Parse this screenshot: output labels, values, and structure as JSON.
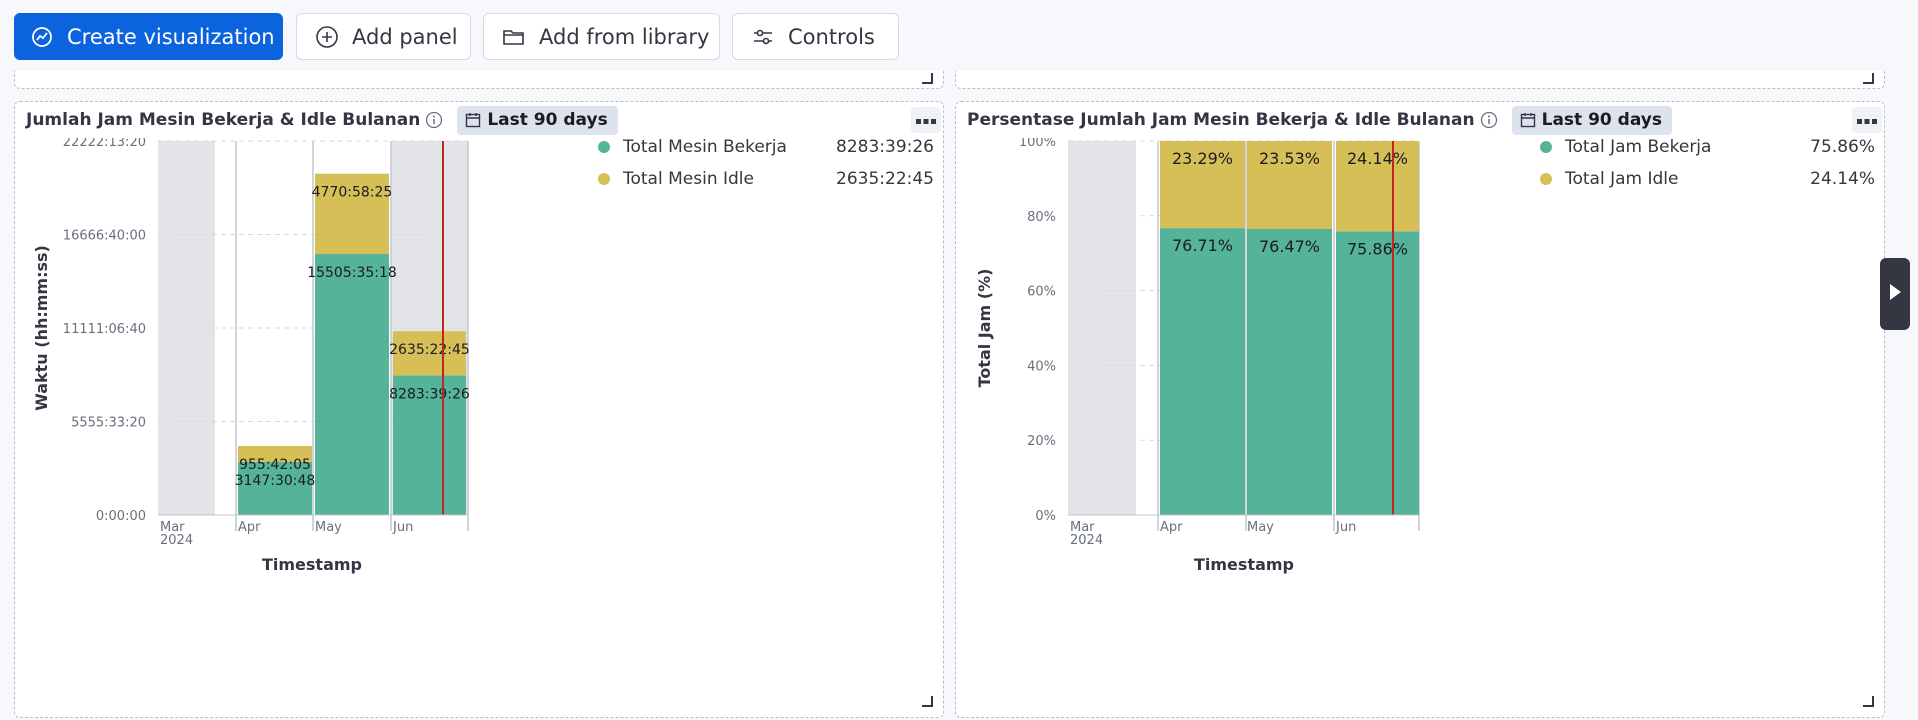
{
  "toolbar": {
    "create_label": "Create visualization",
    "add_panel_label": "Add panel",
    "add_library_label": "Add from library",
    "controls_label": "Controls"
  },
  "panel_left": {
    "title": "Jumlah Jam Mesin Bekerja & Idle Bulanan",
    "time_badge": "Last 90 days",
    "legend": [
      {
        "label": "Total Mesin Bekerja",
        "value": "8283:39:26",
        "color": "#54b399"
      },
      {
        "label": "Total Mesin Idle",
        "value": "2635:22:45",
        "color": "#d6bf57"
      }
    ]
  },
  "panel_right": {
    "title": "Persentase Jumlah Jam Mesin Bekerja & Idle Bulanan",
    "time_badge": "Last 90 days",
    "legend": [
      {
        "label": "Total Jam Bekerja",
        "value": "75.86%",
        "color": "#54b399"
      },
      {
        "label": "Total Jam Idle",
        "value": "24.14%",
        "color": "#d6bf57"
      }
    ]
  },
  "chart_data": [
    {
      "type": "bar",
      "stacked": true,
      "categories": [
        "Apr",
        "May",
        "Jun"
      ],
      "x_tick_labels": [
        "Mar",
        "Apr",
        "May",
        "Jun"
      ],
      "x_year_label": "2024",
      "xlabel": "Timestamp",
      "ylabel": "Waktu (hh:mm:ss)",
      "y_tick_labels": [
        "0:00:00",
        "5555:33:20",
        "11111:06:40",
        "16666:40:00",
        "22222:13:20"
      ],
      "ylim_hours": [
        0,
        22222.22
      ],
      "series": [
        {
          "name": "Total Mesin Bekerja",
          "color": "#54b399",
          "values_hours": [
            3147.51,
            15505.59,
            8283.66
          ],
          "labels": [
            "3147:30:48",
            "15505:35:18",
            "8283:39:26"
          ]
        },
        {
          "name": "Total Mesin Idle",
          "color": "#d6bf57",
          "values_hours": [
            955.7,
            4770.97,
            2635.38
          ],
          "labels": [
            "955:42:05",
            "4770:58:25",
            "2635:22:45"
          ]
        }
      ],
      "grid": true,
      "legend_position": "right"
    },
    {
      "type": "bar",
      "stacked": true,
      "percent": true,
      "categories": [
        "Apr",
        "May",
        "Jun"
      ],
      "x_tick_labels": [
        "Mar",
        "Apr",
        "May",
        "Jun"
      ],
      "x_year_label": "2024",
      "xlabel": "Timestamp",
      "ylabel": "Total Jam (%)",
      "y_tick_labels": [
        "0%",
        "20%",
        "40%",
        "60%",
        "80%",
        "100%"
      ],
      "ylim": [
        0,
        100
      ],
      "series": [
        {
          "name": "Total Jam Bekerja",
          "color": "#54b399",
          "values": [
            76.71,
            76.47,
            75.86
          ],
          "labels": [
            "76.71%",
            "76.47%",
            "75.86%"
          ]
        },
        {
          "name": "Total Jam Idle",
          "color": "#d6bf57",
          "values": [
            23.29,
            23.53,
            24.14
          ],
          "labels": [
            "23.29%",
            "23.53%",
            "24.14%"
          ]
        }
      ],
      "grid": true,
      "legend_position": "right"
    }
  ]
}
